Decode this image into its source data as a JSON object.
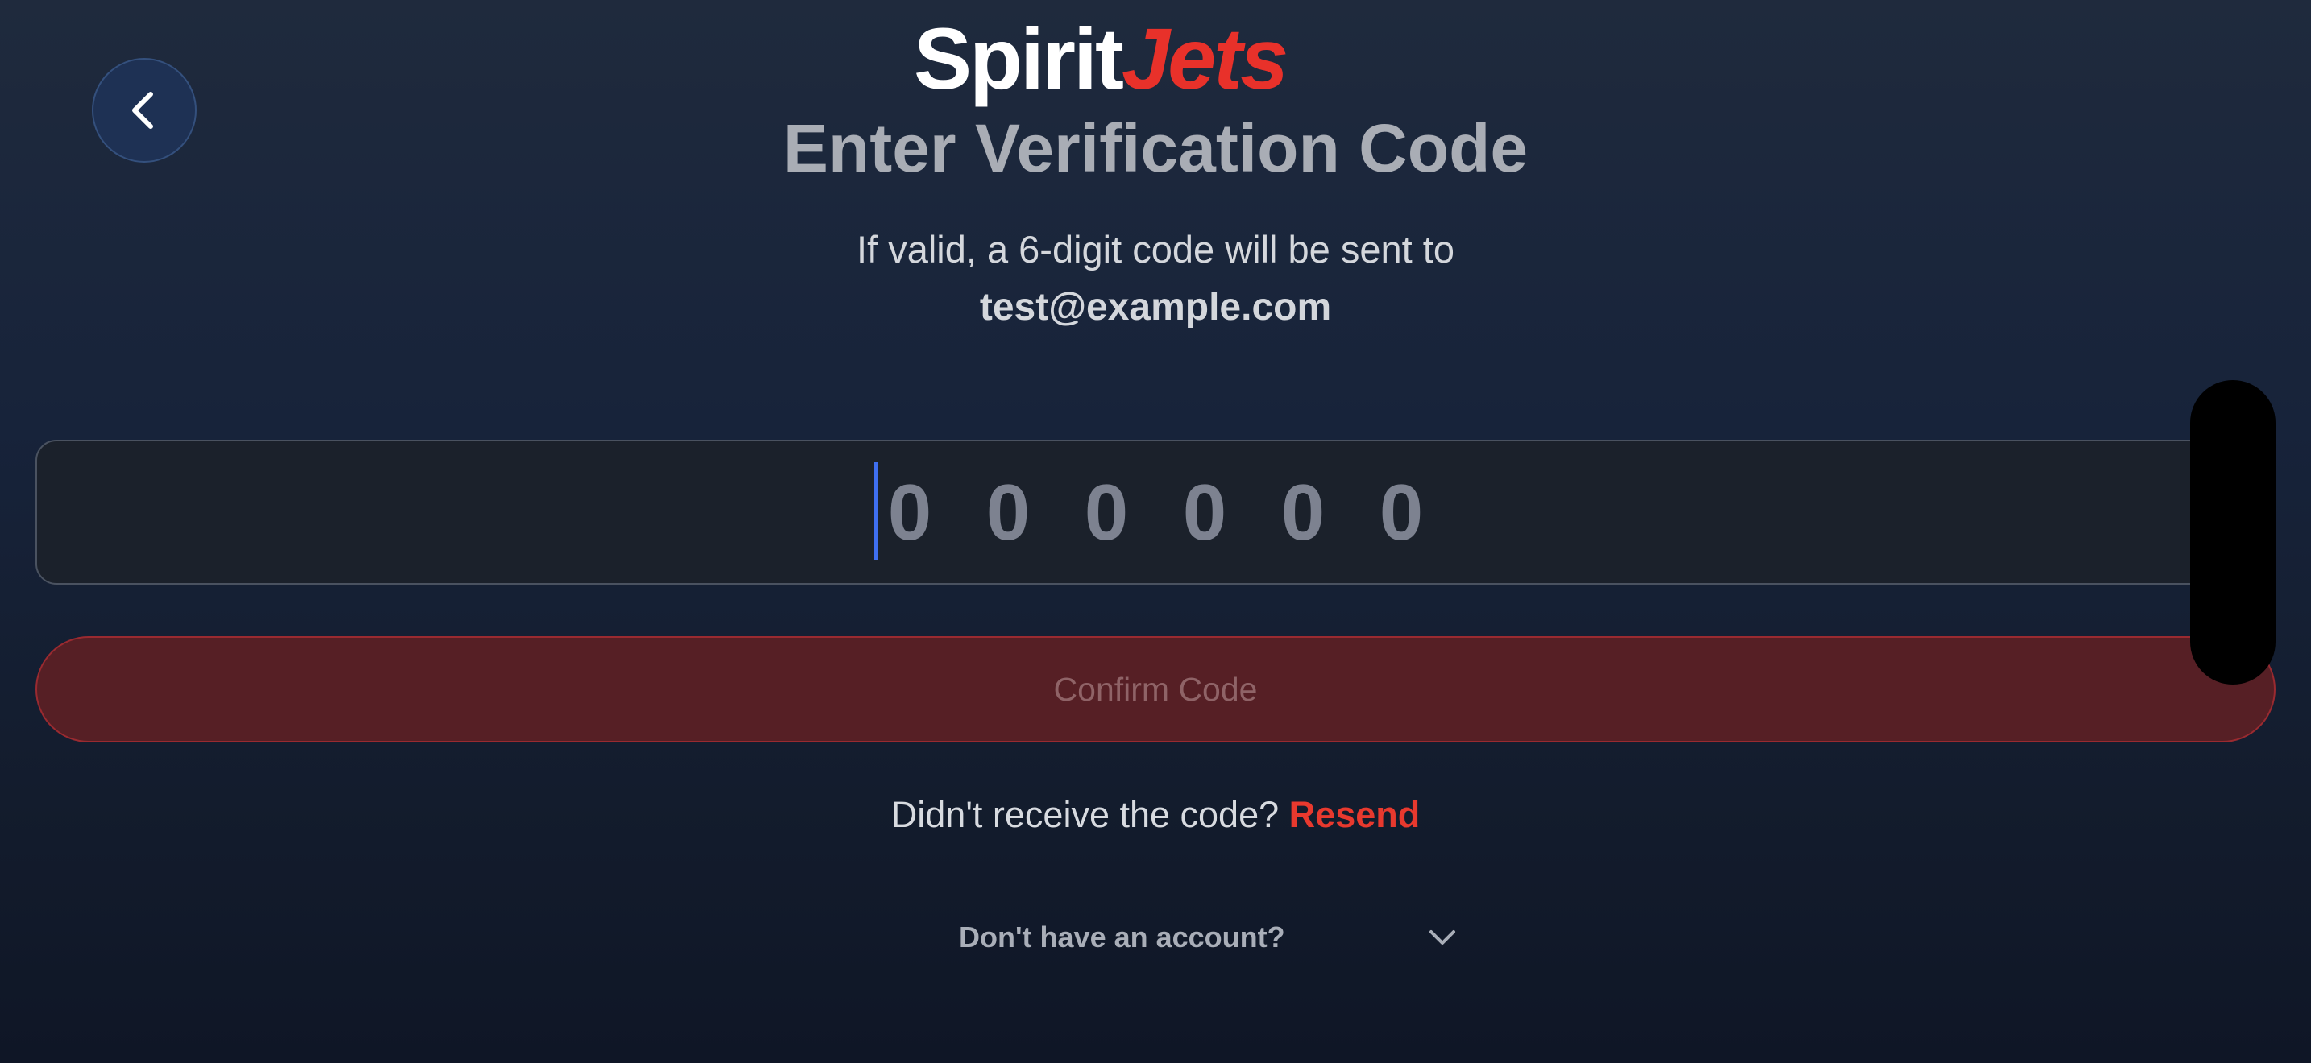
{
  "header": {
    "back_icon": "chevron-left-icon",
    "logo": {
      "part1": "Spirit",
      "part2": "Jets"
    }
  },
  "title": "Enter Verification Code",
  "subtitle": "If valid, a 6-digit code will be sent to",
  "email": "test@example.com",
  "code_input": {
    "placeholder_digits": [
      "0",
      "0",
      "0",
      "0",
      "0",
      "0"
    ]
  },
  "confirm_button": {
    "label": "Confirm Code"
  },
  "resend": {
    "prompt": "Didn't receive the code?",
    "link": "Resend"
  },
  "account": {
    "label": "Don't have an account?",
    "icon": "chevron-down-icon"
  },
  "colors": {
    "accent_red": "#e8312a",
    "caret_blue": "#3f6ff0",
    "button_bg": "#561f25"
  }
}
